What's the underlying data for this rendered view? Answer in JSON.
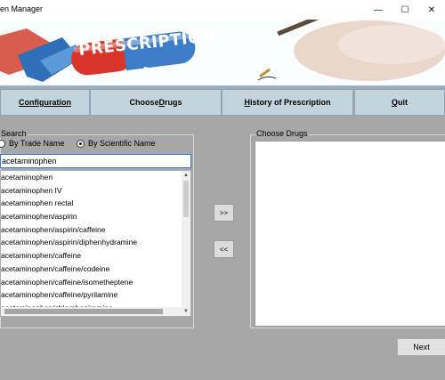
{
  "window": {
    "title": "en Manager",
    "minimize_glyph": "—",
    "maximize_glyph": "☐",
    "close_glyph": "✕"
  },
  "banner": {
    "text": "PRESCRIPTION"
  },
  "nav": {
    "configuration": "Configuration",
    "choose_drugs_pre": "Choose ",
    "choose_drugs_u": "D",
    "choose_drugs_post": "rugs",
    "history_u": "H",
    "history_post": "istory of Prescription",
    "quit_u": "Q",
    "quit_post": "uit"
  },
  "search": {
    "group_label": "Search",
    "by_trade_name": "By Trade Name",
    "by_scientific_name": "By Scientific Name",
    "selected_mode": "By Scientific Name",
    "query": "acetaminophen",
    "results": [
      "acetaminophen",
      "acetaminophen IV",
      "acetaminophen rectal",
      "acetaminophen/aspirin",
      "acetaminophen/aspirin/caffeine",
      "acetaminophen/aspirin/diphenhydramine",
      "acetaminophen/caffeine",
      "acetaminophen/caffeine/codeine",
      "acetaminophen/caffeine/isometheptene",
      "acetaminophen/caffeine/pyrilamine",
      "acetaminophen/chlorpheniramine"
    ]
  },
  "transfer": {
    "add": ">>",
    "remove": "<<"
  },
  "chosen": {
    "group_label": "Choose Drugs"
  },
  "footer": {
    "next": "Next"
  },
  "colors": {
    "background": "#a7a7a7",
    "nav_button": "#c4d4df",
    "pill_red": "#d9352b",
    "pill_blue": "#3c7cc8"
  }
}
